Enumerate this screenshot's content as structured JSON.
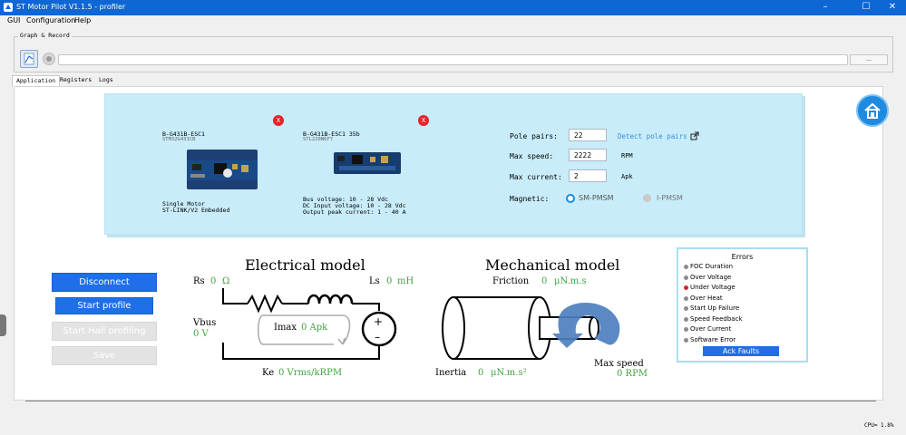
{
  "window": {
    "title": "ST Motor Pilot V1.1.5 - profiler",
    "minimize": "–",
    "maximize": "☐",
    "close": "✕"
  },
  "menu": [
    "GUI",
    "Configuration",
    "Help"
  ],
  "graph_record": {
    "title": "Graph & Record",
    "browse_label": "..."
  },
  "tabs": [
    "Application",
    "Registers",
    "Logs"
  ],
  "boards": [
    {
      "name": "B-G431B-ESC1",
      "chip": "STM32G431CB",
      "desc1": "Single Motor",
      "desc2": "ST-LINK/V2 Embedded",
      "remove": "X"
    },
    {
      "name": "B-G431B-ESC1 35b",
      "chip": "STL220N6F7",
      "desc1": "Bus voltage: 10 - 28 Vdc",
      "desc2": "DC Input voltage: 10 - 28 Vdc",
      "desc3": "Output peak current: 1 - 40 A",
      "remove": "X"
    }
  ],
  "params": {
    "pole_pairs_label": "Pole pairs:",
    "pole_pairs_value": "22",
    "detect_link": "Detect pole pairs",
    "max_speed_label": "Max speed:",
    "max_speed_value": "2222",
    "max_speed_unit": "RPM",
    "max_current_label": "Max current:",
    "max_current_value": "2",
    "max_current_unit": "Apk",
    "magnetic_label": "Magnetic:",
    "magnetic_opt1": "SM-PMSM",
    "magnetic_opt2": "I-PMSM"
  },
  "buttons": {
    "disconnect": "Disconnect",
    "start_profile": "Start profile",
    "start_hall": "Start Hall profiling",
    "save": "Save"
  },
  "electrical": {
    "title": "Electrical model",
    "rs_label": "Rs",
    "rs_value": "0",
    "rs_unit": "Ω",
    "ls_label": "Ls",
    "ls_value": "0",
    "ls_unit": "mH",
    "vbus_label": "Vbus",
    "vbus_value": "0 V",
    "imax_label": "Imax",
    "imax_value": "0 Apk",
    "ke_label": "Ke",
    "ke_value": "0 Vrms/kRPM"
  },
  "mechanical": {
    "title": "Mechanical model",
    "friction_label": "Friction",
    "friction_value": "0",
    "friction_unit": "μN.m.s",
    "inertia_label": "Inertia",
    "inertia_value": "0",
    "inertia_unit": "μN.m.s²",
    "maxspeed_label": "Max speed",
    "maxspeed_value": "0 RPM"
  },
  "errors": {
    "title": "Errors",
    "items": [
      "FOC Duration",
      "Over Voltage",
      "Under Voltage",
      "Over Heat",
      "Start Up Failure",
      "Speed Feedback",
      "Over Current",
      "Software Error"
    ],
    "ack": "Ack Faults"
  },
  "status": {
    "cpu": "CPU= 1.8%"
  },
  "colors": {
    "titlebar": "#0e67d5",
    "button_blue": "#1e6fe8",
    "value_green": "#3fa43f",
    "error_red": "#d0272f",
    "panel_cyan": "#c8ecf9"
  }
}
